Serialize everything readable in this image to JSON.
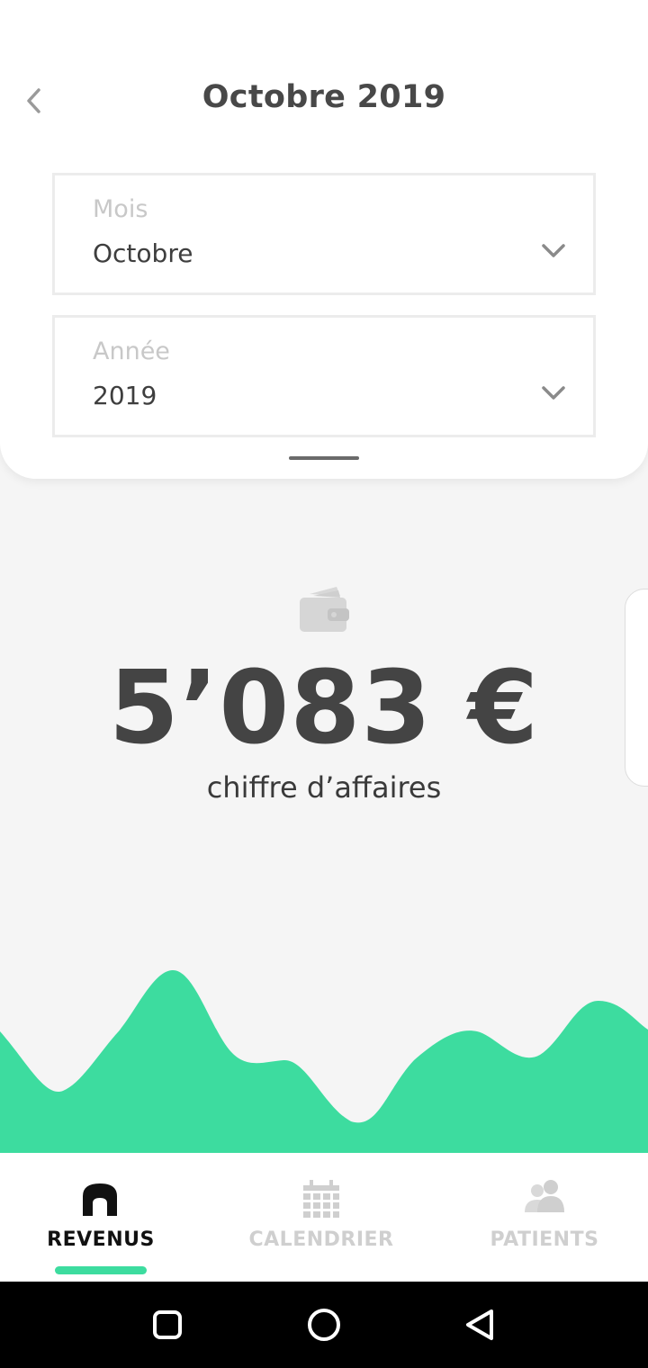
{
  "header": {
    "title": "Octobre 2019"
  },
  "filters": {
    "month": {
      "label": "Mois",
      "value": "Octobre"
    },
    "year": {
      "label": "Année",
      "value": "2019"
    }
  },
  "summary": {
    "amount": "5’083 €",
    "caption": "chiffre d’affaires",
    "icon": "wallet-icon"
  },
  "nav": {
    "items": [
      {
        "label": "REVENUS",
        "icon": "home-icon",
        "active": true
      },
      {
        "label": "CALENDRIER",
        "icon": "calendar-icon",
        "active": false
      },
      {
        "label": "PATIENTS",
        "icon": "patients-icon",
        "active": false
      }
    ]
  },
  "system_nav": {
    "buttons": [
      "recent-apps-icon",
      "home-circle-icon",
      "back-triangle-icon"
    ]
  },
  "colors": {
    "accent": "#3ddc9f",
    "text": "#444444",
    "muted": "#cfcfcf",
    "background": "#f5f5f5"
  }
}
